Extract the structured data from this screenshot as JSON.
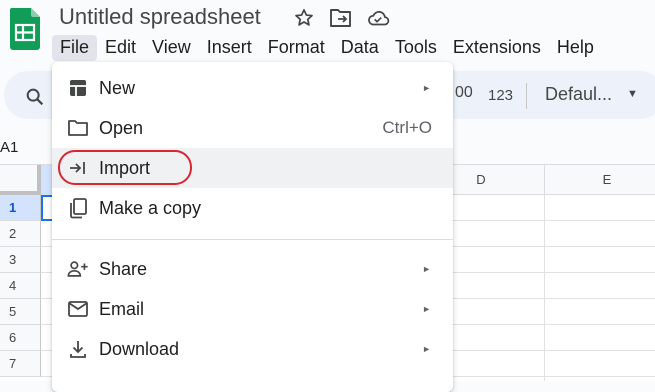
{
  "document": {
    "title": "Untitled spreadsheet"
  },
  "title_icons": [
    "star-icon",
    "move-to-folder-icon",
    "cloud-saved-icon"
  ],
  "menubar": {
    "items": [
      "File",
      "Edit",
      "View",
      "Insert",
      "Format",
      "Data",
      "Tools",
      "Extensions",
      "Help"
    ],
    "active": "File"
  },
  "toolbar": {
    "decimal_label": "00",
    "number_format_label": "123",
    "font_label": "Defaul..."
  },
  "namebox": {
    "value": "A1"
  },
  "grid": {
    "columns": [
      "D",
      "E"
    ],
    "rows": [
      "1",
      "2",
      "3",
      "4",
      "5",
      "6",
      "7"
    ],
    "selected_row": "1"
  },
  "file_menu": {
    "items": [
      {
        "label": "New",
        "icon": "sheet-grid-icon",
        "submenu": true
      },
      {
        "label": "Open",
        "icon": "folder-icon",
        "shortcut": "Ctrl+O"
      },
      {
        "label": "Import",
        "icon": "import-arrow-icon",
        "highlighted": true
      },
      {
        "label": "Make a copy",
        "icon": "copy-icon"
      },
      {
        "label": "Share",
        "icon": "person-add-icon",
        "submenu": true
      },
      {
        "label": "Email",
        "icon": "mail-icon",
        "submenu": true
      },
      {
        "label": "Download",
        "icon": "download-icon",
        "submenu": true
      }
    ],
    "submenu_arrow": "►"
  },
  "colors": {
    "accent": "#0b57d0",
    "highlight_ring": "#d9262f",
    "logo_green": "#0f9d58"
  }
}
